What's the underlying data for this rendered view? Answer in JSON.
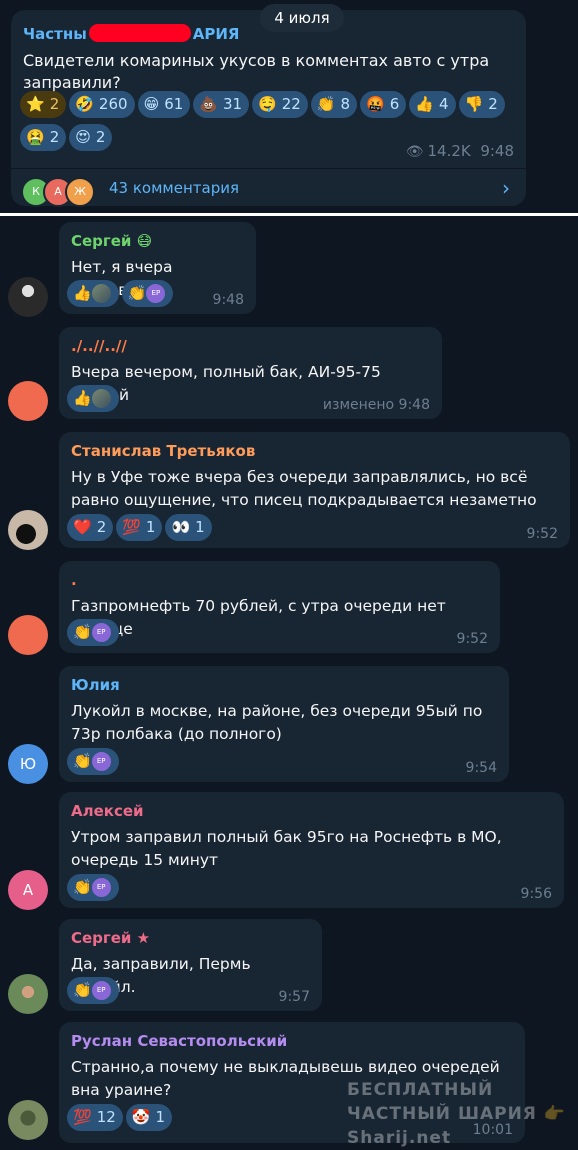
{
  "date_label": "4 июля",
  "post": {
    "channel_prefix": "Частны",
    "channel_suffix": "АРИЯ",
    "text": "Свидетели комариных укусов в комментах авто с утра заправили?",
    "reactions": [
      {
        "emoji": "⭐",
        "count": "2"
      },
      {
        "emoji": "🤣",
        "count": "260"
      },
      {
        "emoji": "😁",
        "count": "61"
      },
      {
        "emoji": "💩",
        "count": "31"
      },
      {
        "emoji": "🤤",
        "count": "22"
      },
      {
        "emoji": "👏",
        "count": "8"
      },
      {
        "emoji": "🤬",
        "count": "6"
      },
      {
        "emoji": "👍",
        "count": "4"
      },
      {
        "emoji": "👎",
        "count": "2"
      },
      {
        "emoji": "🤮",
        "count": "2"
      },
      {
        "emoji": "😍",
        "count": "2"
      }
    ],
    "views": "14.2K",
    "time": "9:48",
    "comments_label": "43 комментария",
    "commenter_initials": [
      "К",
      "А",
      "Ж"
    ]
  },
  "messages": [
    {
      "name": "Сергей 😷",
      "name_color": "#6ed46b",
      "text": "Нет, я вчера заправил",
      "reactions": [
        {
          "emoji": "👍",
          "avatars": [
            "ph"
          ]
        },
        {
          "emoji": "👏",
          "avatars": [
            "ep"
          ]
        }
      ],
      "time": "9:48",
      "avatar": "photo1"
    },
    {
      "name": "./..//..//",
      "name_color": "#ff7a45",
      "text": "Вчера вечером, полный бак, АИ-95-75 рублей",
      "reactions": [
        {
          "emoji": "👍",
          "avatars": [
            "ph"
          ]
        }
      ],
      "time": "изменено 9:48",
      "avatar": "orange"
    },
    {
      "name": "Станислав Третьяков",
      "name_color": "#ff9c5a",
      "text": "Ну в Уфе тоже вчера без очереди заправлялись, но всё равно ощущение, что писец подкрадывается незаметно",
      "reactions": [
        {
          "emoji": "❤️",
          "count": "2"
        },
        {
          "emoji": "💯",
          "count": "1"
        },
        {
          "emoji": "👀",
          "count": "1"
        }
      ],
      "time": "9:52",
      "avatar": "photo2"
    },
    {
      "name": ".",
      "name_color": "#ff7a45",
      "text": "Газпромнефть 70 рублей, с утра очереди нет вообще",
      "reactions": [
        {
          "emoji": "👏",
          "avatars": [
            "ep"
          ]
        }
      ],
      "time": "9:52",
      "avatar": "orange"
    },
    {
      "name": "Юлия",
      "name_color": "#5eb5f7",
      "text": "Лукойл в москве, на районе, без очереди 95ый по 73р полбака (до полного)",
      "reactions": [
        {
          "emoji": "👏",
          "avatars": [
            "ep"
          ]
        }
      ],
      "time": "9:54",
      "avatar": "Ю"
    },
    {
      "name": "Алексей",
      "name_color": "#ee6b8a",
      "text": "Утром заправил полный бак 95го на Роснефть в МО, очередь 15 минут",
      "reactions": [
        {
          "emoji": "👏",
          "avatars": [
            "ep"
          ]
        }
      ],
      "time": "9:56",
      "avatar": "А"
    },
    {
      "name": "Сергей ★",
      "name_color": "#ee6b8a",
      "text": "Да, заправили, Пермь Лукойл.",
      "reactions": [
        {
          "emoji": "👏",
          "avatars": [
            "ep"
          ]
        }
      ],
      "time": "9:57",
      "avatar": "photo3"
    },
    {
      "name": "Руслан Севастопольский",
      "name_color": "#b58cf0",
      "text": "Странно,а почему не выкладывешь видео очередей вна ураине?",
      "reactions": [
        {
          "emoji": "💯",
          "count": "12"
        },
        {
          "emoji": "🤡",
          "count": "1"
        }
      ],
      "time": "10:01",
      "avatar": "photo4"
    }
  ],
  "mini_avatar_text": "ЕР",
  "watermark": "БЕСПЛАТНЫЙ ЧАСТНЫЙ ШАРИЯ 👉 Sharij.net"
}
